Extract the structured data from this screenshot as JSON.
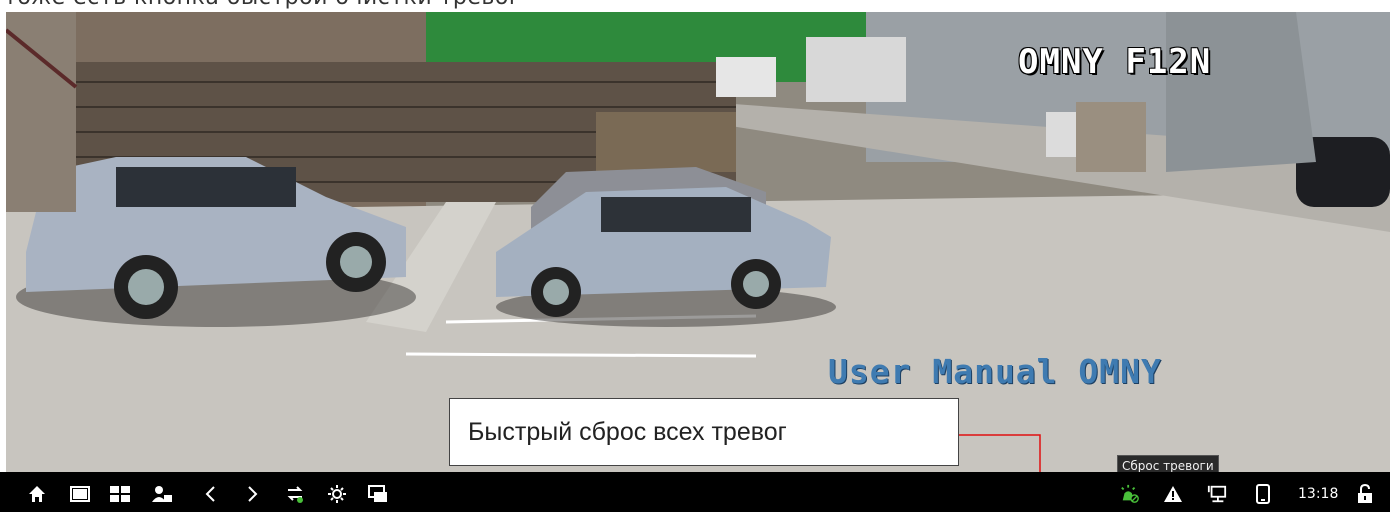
{
  "caption": {
    "text": "тоже есть кнопка быстрой очистки тревог"
  },
  "feed": {
    "osd_title": "OMNY F12N",
    "watermark": "User Manual OMNY"
  },
  "callout": {
    "text": "Быстрый сброс всех тревог"
  },
  "tooltip": {
    "text": "Сброс тревоги"
  },
  "taskbar": {
    "clock": "13:18",
    "left_icons": [
      "home-icon",
      "single-view-icon",
      "grid-view-icon",
      "user-icon",
      "prev-icon",
      "next-icon",
      "switch-icon",
      "brightness-icon",
      "display-icon"
    ],
    "right_icons": [
      "alarm-reset-icon",
      "warning-icon",
      "network-icon",
      "mobile-icon",
      "lock-icon"
    ]
  },
  "colors": {
    "taskbar_bg": "#000000",
    "alarm_icon": "#49c03a",
    "callout_arrow": "#e01010",
    "watermark": "#3f7bb1"
  }
}
